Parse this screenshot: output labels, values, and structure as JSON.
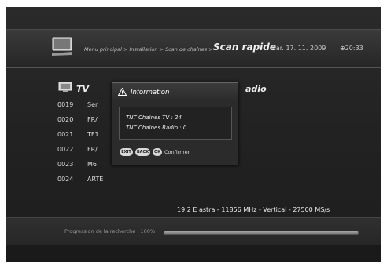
{
  "header": {
    "breadcrumb": "Menu principal > Installation > Scan de chaînes >",
    "title": "Scan rapide",
    "date": "Mar. 17. 11. 2009",
    "time": "20:33"
  },
  "lists": {
    "tv_label": "TV",
    "radio_label": "adio"
  },
  "channels": [
    {
      "num": "0019",
      "name": "Ser"
    },
    {
      "num": "0020",
      "name": "FR/"
    },
    {
      "num": "0021",
      "name": "TF1"
    },
    {
      "num": "0022",
      "name": "FR/"
    },
    {
      "num": "0023",
      "name": "M6"
    },
    {
      "num": "0024",
      "name": "ARTE"
    }
  ],
  "popup": {
    "title": "Information",
    "line1": "TNT Chaînes TV : 24",
    "line2": "TNT Chaînes Radio : 0",
    "btn_exit": "EXIT",
    "btn_back": "BACK",
    "btn_ok": "OK",
    "confirm": "Confirmer"
  },
  "transponder": "19.2 E astra - 11856 MHz - Vertical - 27500 MS/s",
  "progress": {
    "label": "Progression de la recherche : 100%",
    "value": 1.0
  },
  "colors": {
    "background": "#242424",
    "accent": "#dddddd"
  }
}
